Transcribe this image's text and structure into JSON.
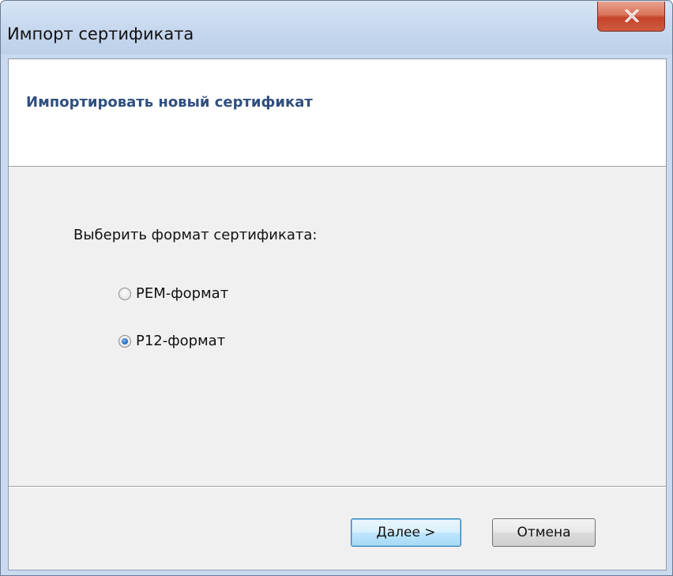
{
  "window": {
    "title": "Импорт сертификата",
    "close_label": "X"
  },
  "header": {
    "title": "Импортировать новый сертификат"
  },
  "main": {
    "prompt": "Выберить формат сертификата:",
    "options": [
      {
        "label": "PEM-формат",
        "checked": false
      },
      {
        "label": "P12-формат",
        "checked": true
      }
    ]
  },
  "footer": {
    "next_label": "Далее >",
    "cancel_label": "Отмена"
  },
  "colors": {
    "header_title": "#2f4f7f",
    "close_button": "#c4442b",
    "default_button_border": "#3c7fb1"
  }
}
